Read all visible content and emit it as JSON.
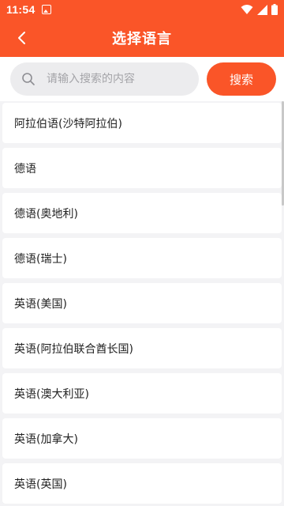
{
  "status": {
    "time": "11:54"
  },
  "header": {
    "title": "选择语言",
    "back_icon": "chevron-left-icon"
  },
  "search": {
    "placeholder": "请输入搜索的内容",
    "value": "",
    "button_label": "搜索",
    "icon": "search-icon"
  },
  "languages": [
    "阿拉伯语(沙特阿拉伯)",
    "德语",
    "德语(奥地利)",
    "德语(瑞士)",
    "英语(美国)",
    "英语(阿拉伯联合酋长国)",
    "英语(澳大利亚)",
    "英语(加拿大)",
    "英语(英国)"
  ],
  "colors": {
    "accent": "#fa5528",
    "background": "#f3f3f5",
    "search_bg": "#ececee"
  }
}
